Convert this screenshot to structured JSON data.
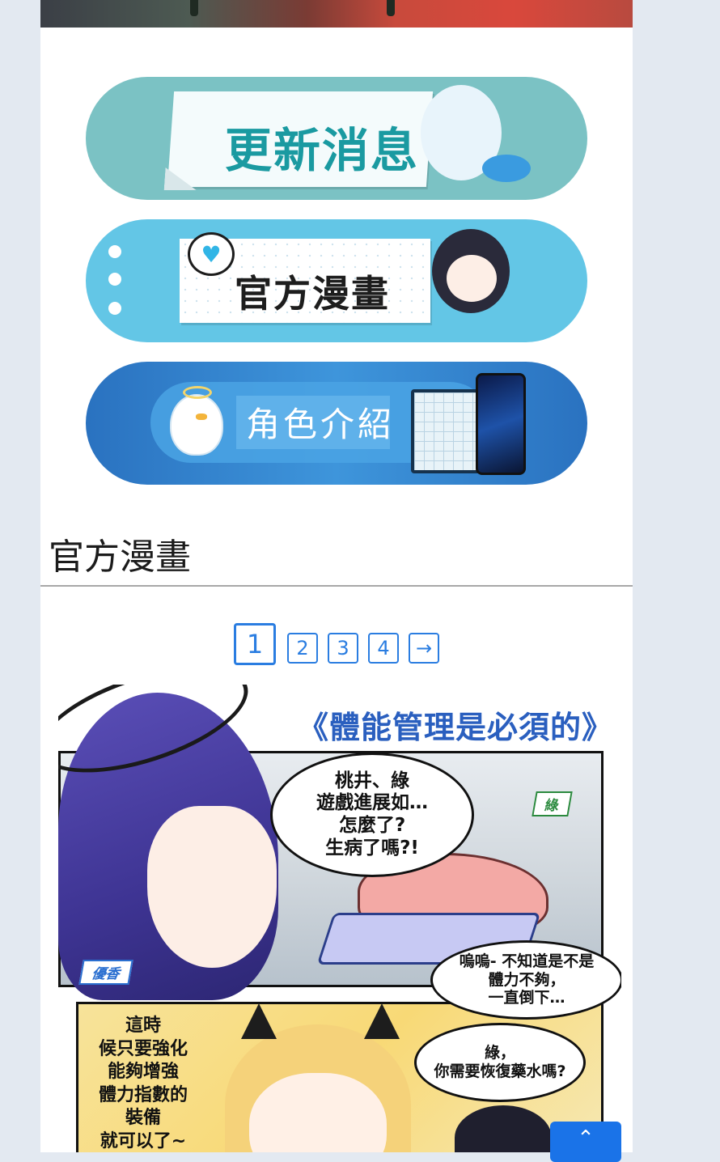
{
  "menu": {
    "buttons": [
      {
        "label": "更新消息",
        "accent": "#1a9aa1"
      },
      {
        "label": "官方漫畫",
        "accent": "#1d1d1d"
      },
      {
        "label": "角色介紹",
        "accent": "#ffffff"
      }
    ]
  },
  "section": {
    "title": "官方漫畫"
  },
  "pagination": {
    "current": "1",
    "pages": [
      "2",
      "3",
      "4"
    ],
    "next": "→",
    "accent": "#2a7de1"
  },
  "comic": {
    "title": "《體能管理是必須的》",
    "speech_1": "桃井、綠\n遊戲進展如…\n怎麼了?\n生病了嗎?!",
    "tag_midori": "綠",
    "tag_yuuka": "優香",
    "speech_2": "嗚嗚- 不知道是不是\n體力不夠，\n一直倒下…",
    "side_text": "這時\n候只要強化\n能夠增強\n體力指數的\n裝備\n就可以了~",
    "speech_3": "綠，\n你需要恢復藥水嗎?"
  },
  "scroll_top": {
    "icon": "arrow-up-icon",
    "glyph": "⌃",
    "color": "#1a73e8"
  }
}
